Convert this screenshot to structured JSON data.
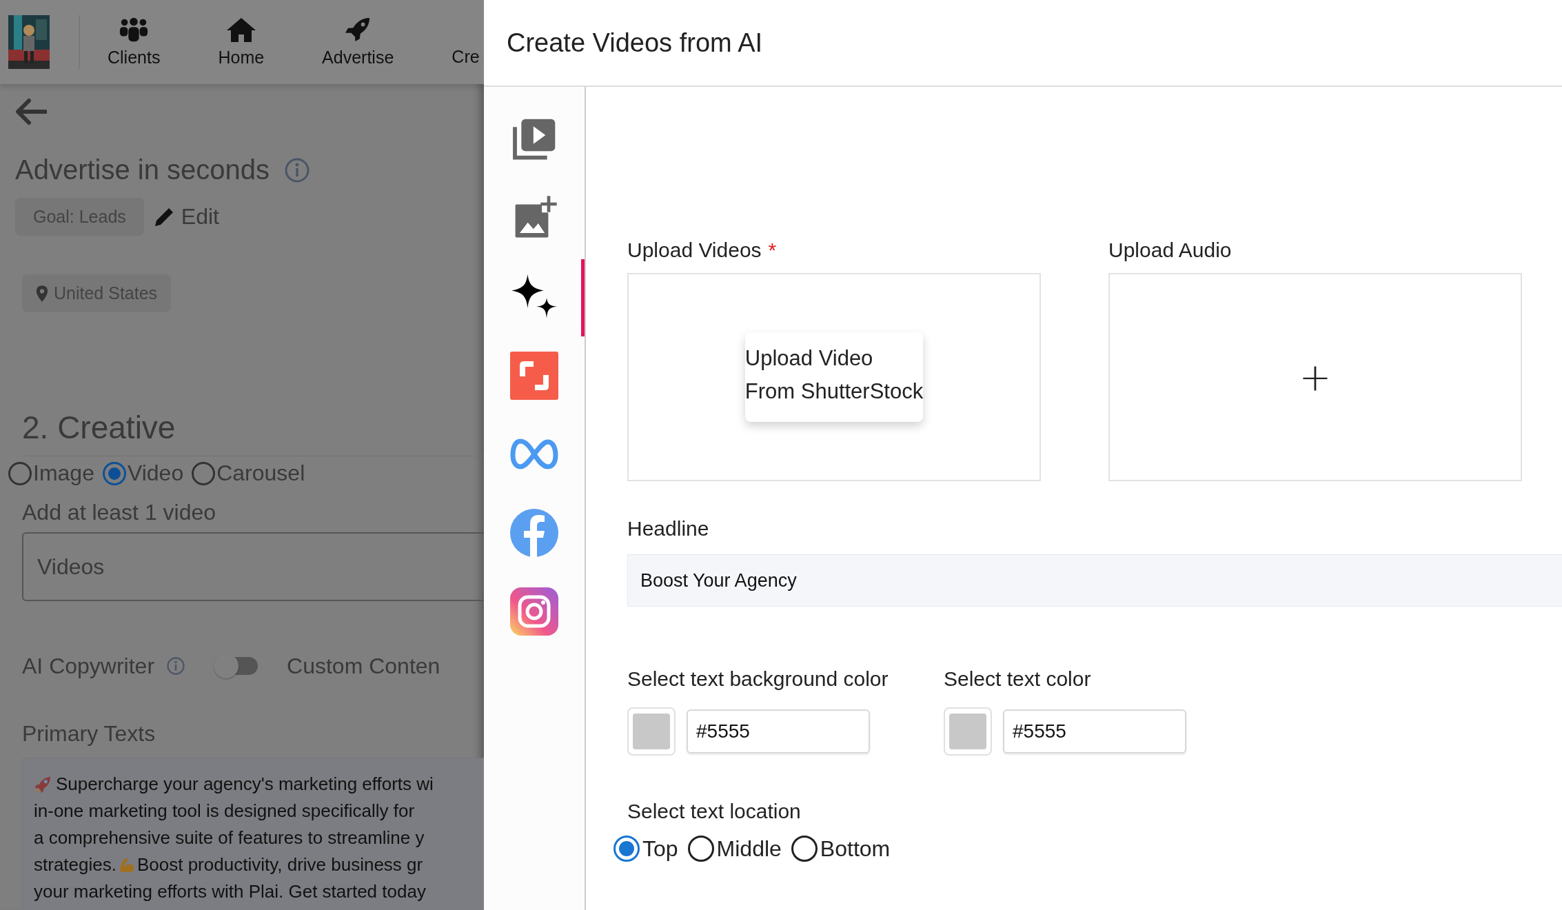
{
  "background_page": {
    "nav": [
      {
        "kind": "clients",
        "label": "Clients"
      },
      {
        "kind": "home",
        "label": "Home"
      },
      {
        "kind": "advertise",
        "label": "Advertise"
      },
      {
        "kind": "none",
        "label": "Cre"
      }
    ],
    "title": "Advertise in seconds",
    "goal_chip": "Goal: Leads",
    "edit_link": "Edit",
    "location_chip": "United States",
    "section_title": "2. Creative",
    "format_options": [
      {
        "label": "Image",
        "selected": false
      },
      {
        "label": "Video",
        "selected": true
      },
      {
        "label": "Carousel",
        "selected": false
      }
    ],
    "videos_label": "Add at least 1 video",
    "videos_field": {
      "placeholder": "Videos"
    },
    "ai_copywriter": {
      "label": "AI Copywriter",
      "on": false
    },
    "custom_content_label": "Custom Conten",
    "primary_texts": {
      "label": "Primary Texts",
      "lines": [
        [
          {
            "kind": "rocket"
          },
          {
            "kind": "text",
            "text": "Supercharge your agency's marketing efforts wi"
          }
        ],
        [
          {
            "kind": "text",
            "text": "in-one marketing tool is designed specifically for"
          }
        ],
        [
          {
            "kind": "text",
            "text": "a comprehensive suite of features to streamline y"
          }
        ],
        [
          {
            "kind": "text",
            "text": "strategies. "
          },
          {
            "kind": "arm"
          },
          {
            "kind": "text",
            "text": " Boost productivity, drive business gr"
          }
        ],
        [
          {
            "kind": "text",
            "text": "your marketing efforts with Plai. Get started today"
          }
        ]
      ]
    }
  },
  "drawer": {
    "title": "Create Videos from AI",
    "rail": [
      {
        "kind": "video-library",
        "selected": false
      },
      {
        "kind": "add-image",
        "selected": false
      },
      {
        "kind": "sparkles",
        "selected": true
      },
      {
        "kind": "shutterstock",
        "selected": false
      },
      {
        "kind": "meta",
        "selected": false
      },
      {
        "kind": "facebook",
        "selected": false
      },
      {
        "kind": "instagram",
        "selected": false
      }
    ],
    "upload_videos": {
      "label": "Upload Videos",
      "required_mark": "*",
      "button_lines": [
        "Upload Video",
        "From ShutterStock"
      ]
    },
    "upload_audio": {
      "label": "Upload Audio",
      "button": "+"
    },
    "headline": {
      "label": "Headline",
      "value": "Boost Your Agency"
    },
    "colors": [
      {
        "label": "Select text background color",
        "value": "#5555"
      },
      {
        "label": "Select text color",
        "value": "#5555"
      }
    ],
    "text_location": {
      "label": "Select text location",
      "options": [
        {
          "label": "Top",
          "selected": true
        },
        {
          "label": "Middle",
          "selected": false
        },
        {
          "label": "Bottom",
          "selected": false
        }
      ]
    }
  }
}
